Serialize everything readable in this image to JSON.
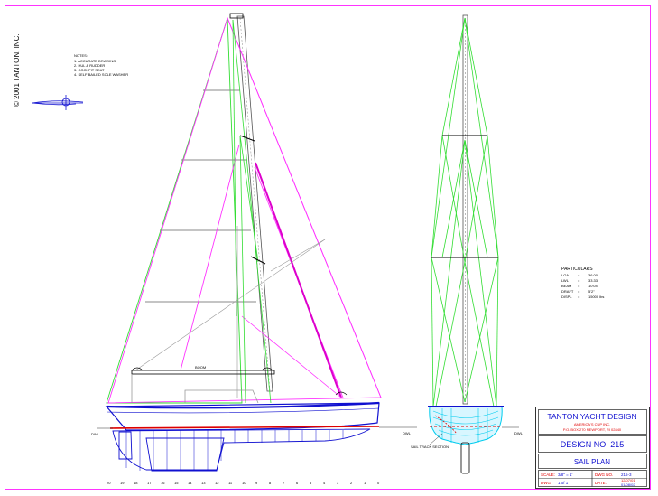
{
  "copyright": "© 2001 TANTON, INC.",
  "notes": {
    "heading": "NOTES:",
    "items": [
      "1. ACCURATE DRAWING",
      "2. HUL & RUDDER",
      "3. COCKPIT SEAT",
      "4. SELF BAILED SOLE WASHER"
    ]
  },
  "particulars": {
    "heading": "PARTICULARS",
    "rows": [
      {
        "label": "LOA",
        "value": "36.00'"
      },
      {
        "label": "LWL",
        "value": "33.33'"
      },
      {
        "label": "BEAM",
        "value": "10'04\""
      },
      {
        "label": "DRAFT",
        "value": "5'2\""
      },
      {
        "label": "DISPL",
        "value": "15000 lbs"
      }
    ]
  },
  "dwl_labels": {
    "profile_left": "DWL",
    "section_left": "DWL",
    "section_right": "DWL"
  },
  "boom_note": "BOOM",
  "section_note": "SAIL TRACK SECTION",
  "station_numbers": [
    "20",
    "19",
    "18",
    "17",
    "16",
    "15",
    "14",
    "13",
    "12",
    "11",
    "10",
    "9",
    "8",
    "7",
    "6",
    "5",
    "4",
    "3",
    "2",
    "1",
    "0"
  ],
  "title_block": {
    "company": "TANTON YACHT DESIGN",
    "subline1": "AMERICA'S CUP INC.",
    "subline2": "P.O. BOX 270 NEWPORT, RI 02840",
    "design": "DESIGN NO. 215",
    "sheet_title": "SAIL PLAN",
    "scale_label": "SCALE:",
    "scale_value": "3/8\" = 1'",
    "dwg_label": "DWG:",
    "dwg_value": "1 of 1",
    "dwg_no_label": "DWG NO.",
    "dwg_no_value": "215-3",
    "date_label": "DATE:",
    "date_value": "12/07/01",
    "rev_value": "01/08/02"
  },
  "colors": {
    "border": "#ff33ff",
    "jib": "#ff33ff",
    "shrouds": "#33dd33",
    "hull_deck": "#1010d0",
    "waterline": "#dd0000",
    "hull_section": "#00ccee",
    "title_text": "#1010d0"
  }
}
